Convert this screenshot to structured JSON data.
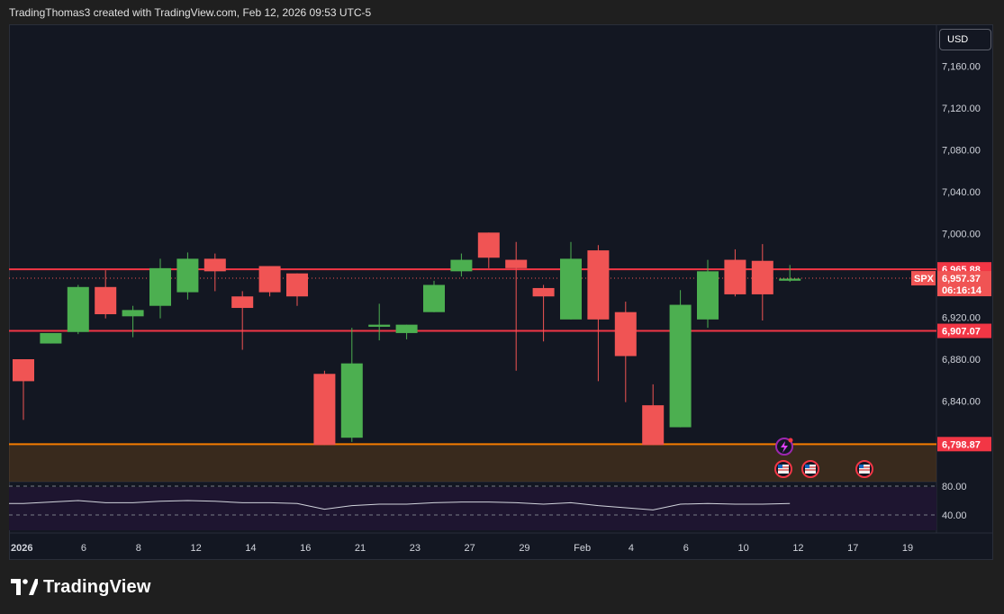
{
  "header": {
    "attribution": "TradingThomas3 created with TradingView.com, Feb 12, 2026 09:53 UTC-5"
  },
  "currency_button": "USD",
  "brand": {
    "name": "TradingView"
  },
  "icons": [
    "usa-flag-icon",
    "lightning-icon",
    "tradingview-logo-icon"
  ],
  "colors": {
    "up": "#4caf50",
    "down": "#f05454",
    "level_line": "#f23645",
    "support_line": "#f57c00",
    "background": "#131722"
  },
  "chart_data": {
    "type": "candlestick",
    "symbol": "SPX",
    "timeframe_note": "daily",
    "ylim": [
      6790,
      7195
    ],
    "y_ticks": [
      "6,840.00",
      "6,880.00",
      "6,920.00",
      "7,000.00",
      "7,040.00",
      "7,080.00",
      "7,120.00",
      "7,160.00"
    ],
    "x_ticks": [
      "2026",
      "6",
      "8",
      "12",
      "14",
      "16",
      "21",
      "23",
      "27",
      "29",
      "Feb",
      "4",
      "6",
      "10",
      "12",
      "17",
      "19"
    ],
    "candles": [
      {
        "o": 6880,
        "h": 6880,
        "l": 6822,
        "c": 6859
      },
      {
        "o": 6895,
        "h": 6900,
        "l": 6895,
        "c": 6905
      },
      {
        "o": 6906,
        "h": 6951,
        "l": 6904,
        "c": 6949
      },
      {
        "o": 6949,
        "h": 6965,
        "l": 6919,
        "c": 6923
      },
      {
        "o": 6921,
        "h": 6931,
        "l": 6901,
        "c": 6927
      },
      {
        "o": 6931,
        "h": 6976,
        "l": 6919,
        "c": 6967
      },
      {
        "o": 6944,
        "h": 6982,
        "l": 6937,
        "c": 6976
      },
      {
        "o": 6976,
        "h": 6981,
        "l": 6945,
        "c": 6964
      },
      {
        "o": 6940,
        "h": 6945,
        "l": 6889,
        "c": 6929
      },
      {
        "o": 6969,
        "h": 6969,
        "l": 6940,
        "c": 6944
      },
      {
        "o": 6962,
        "h": 6962,
        "l": 6931,
        "c": 6940
      },
      {
        "o": 6866,
        "h": 6869,
        "l": 6798,
        "c": 6798
      },
      {
        "o": 6805,
        "h": 6910,
        "l": 6801,
        "c": 6876
      },
      {
        "o": 6911,
        "h": 6933,
        "l": 6898,
        "c": 6913
      },
      {
        "o": 6905,
        "h": 6913,
        "l": 6899,
        "c": 6913
      },
      {
        "o": 6925,
        "h": 6955,
        "l": 6925,
        "c": 6951
      },
      {
        "o": 6964,
        "h": 6981,
        "l": 6959,
        "c": 6975
      },
      {
        "o": 7001,
        "h": 7001,
        "l": 6967,
        "c": 6977
      },
      {
        "o": 6975,
        "h": 6992,
        "l": 6869,
        "c": 6967
      },
      {
        "o": 6948,
        "h": 6951,
        "l": 6897,
        "c": 6940
      },
      {
        "o": 6918,
        "h": 6992,
        "l": 6918,
        "c": 6976
      },
      {
        "o": 6984,
        "h": 6989,
        "l": 6859,
        "c": 6918
      },
      {
        "o": 6925,
        "h": 6935,
        "l": 6839,
        "c": 6883
      },
      {
        "o": 6836,
        "h": 6856,
        "l": 6798,
        "c": 6798
      },
      {
        "o": 6815,
        "h": 6946,
        "l": 6815,
        "c": 6932
      },
      {
        "o": 6918,
        "h": 6975,
        "l": 6910,
        "c": 6964
      },
      {
        "o": 6975,
        "h": 6985,
        "l": 6940,
        "c": 6942
      },
      {
        "o": 6974,
        "h": 6990,
        "l": 6917,
        "c": 6942
      },
      {
        "o": 6955,
        "h": 6970,
        "l": 6954,
        "c": 6957
      }
    ],
    "horizontal_levels": [
      {
        "price": 6965.88,
        "label": "6,965.88",
        "color": "#f23645"
      },
      {
        "price": 6907.07,
        "label": "6,907.07",
        "color": "#f23645"
      },
      {
        "price": 6798.87,
        "label": "6,798.87",
        "color": "#f57c00"
      }
    ],
    "last_price": {
      "symbol": "SPX",
      "price": "6,957.37",
      "countdown": "06:16:14"
    },
    "oscillator": {
      "levels": [
        80,
        40
      ],
      "level_labels": [
        "80.00",
        "40.00"
      ],
      "values": [
        56,
        58,
        60,
        57,
        57,
        59,
        60,
        59,
        57,
        57,
        56,
        48,
        53,
        55,
        55,
        57,
        58,
        58,
        57,
        55,
        57,
        53,
        50,
        47,
        55,
        56,
        55,
        55,
        56
      ]
    }
  }
}
